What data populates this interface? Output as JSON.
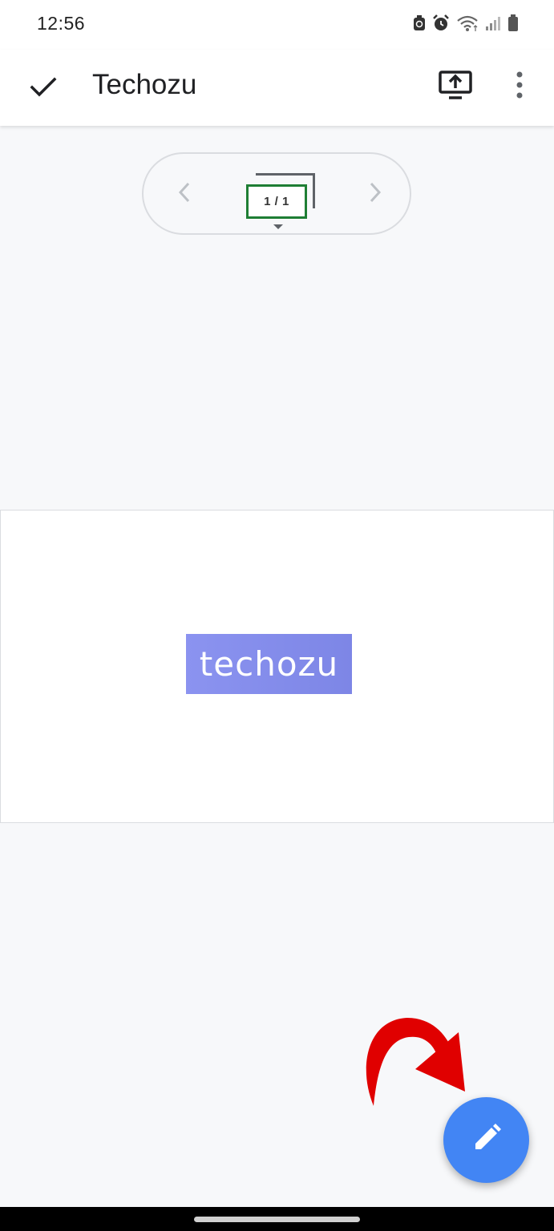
{
  "status_bar": {
    "time": "12:56",
    "icons": [
      "sync-icon",
      "alarm-icon",
      "wifi-icon",
      "signal-icon",
      "battery-icon"
    ]
  },
  "app_bar": {
    "title": "Techozu",
    "done_icon": "check-icon",
    "present_icon": "present-to-screen-icon",
    "more_icon": "more-vert-icon"
  },
  "slide_navigator": {
    "prev_icon": "chevron-left-icon",
    "next_icon": "chevron-right-icon",
    "counter": "1 / 1",
    "accent_color": "#1e7e34"
  },
  "slide": {
    "logo_text": "techozu",
    "logo_color": "#8b93f0"
  },
  "annotation": {
    "arrow_icon": "curved-arrow-icon",
    "arrow_color": "#e00000"
  },
  "fab": {
    "icon": "pencil-icon",
    "color": "#4285f4"
  }
}
